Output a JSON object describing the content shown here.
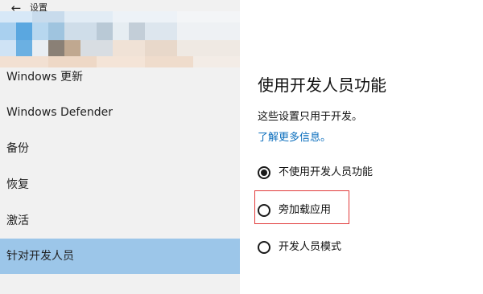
{
  "window": {
    "back_icon": "back-arrow-icon",
    "title": "设置"
  },
  "sidebar": {
    "items": [
      {
        "label": "Windows 更新",
        "selected": false
      },
      {
        "label": "Windows Defender",
        "selected": false
      },
      {
        "label": "备份",
        "selected": false
      },
      {
        "label": "恢复",
        "selected": false
      },
      {
        "label": "激活",
        "selected": false
      },
      {
        "label": "针对开发人员",
        "selected": true
      }
    ]
  },
  "main": {
    "title": "使用开发人员功能",
    "description": "这些设置只用于开发。",
    "learn_more": "了解更多信息。",
    "options": [
      {
        "label": "不使用开发人员功能",
        "checked": true
      },
      {
        "label": "旁加载应用",
        "checked": false
      },
      {
        "label": "开发人员模式",
        "checked": false
      }
    ]
  },
  "colors": {
    "sidebar_bg": "#f1f1f1",
    "selected_bg": "#9cc6e9",
    "link": "#0b6ebd",
    "highlight_border": "#e13a3a"
  }
}
